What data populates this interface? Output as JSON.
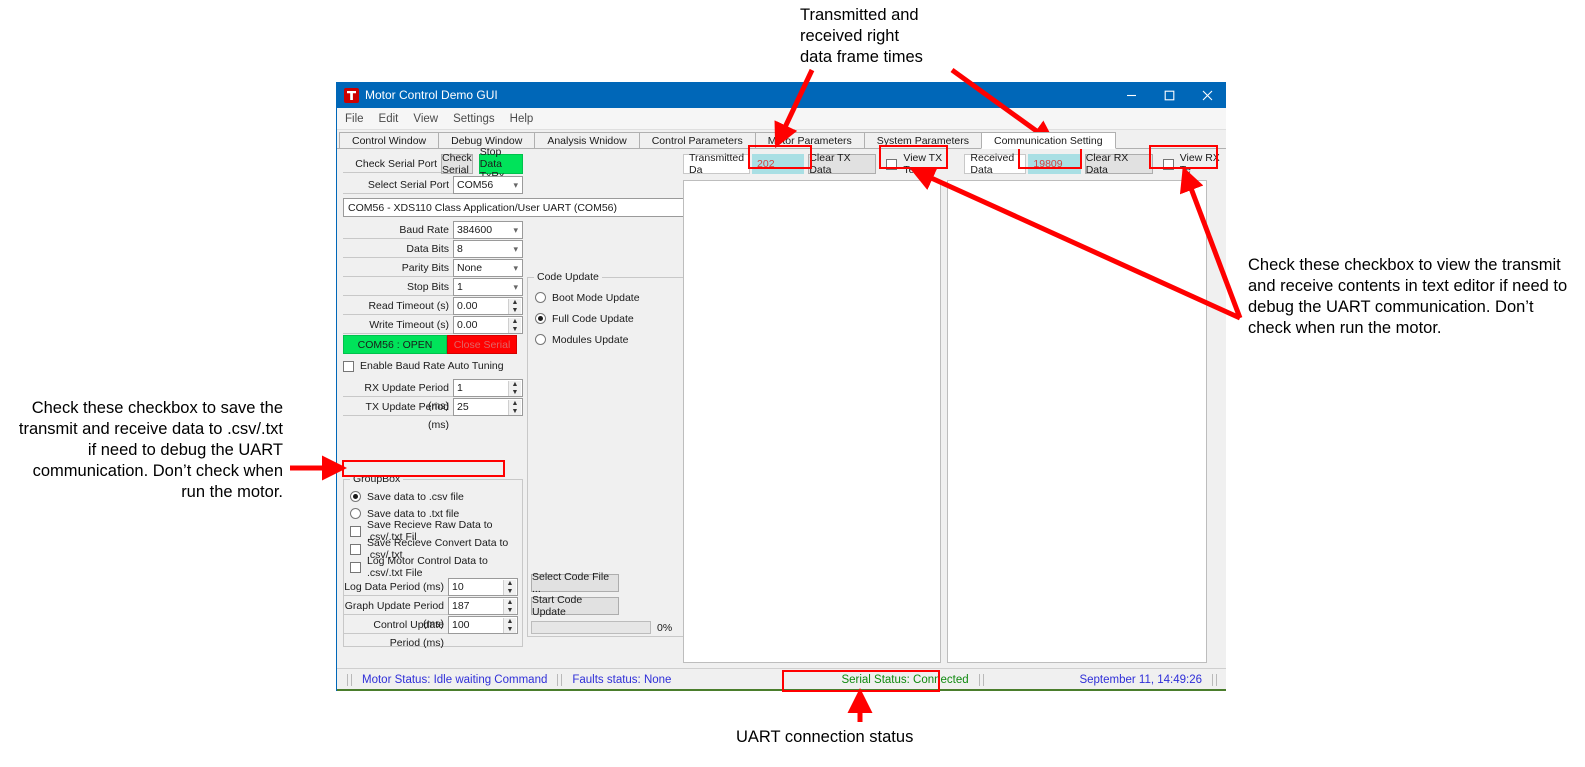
{
  "window": {
    "title": "Motor Control Demo GUI",
    "logo_icon": "ti-logo-icon",
    "minimize_icon": "minimize-icon",
    "maximize_icon": "maximize-icon",
    "close_icon": "close-icon"
  },
  "menubar": {
    "items": [
      "File",
      "Edit",
      "View",
      "Settings",
      "Help"
    ]
  },
  "tabs": [
    {
      "label": "Control Window",
      "active": false
    },
    {
      "label": "Debug Window",
      "active": false
    },
    {
      "label": "Analysis Wnidow",
      "active": false
    },
    {
      "label": "Control Parameters",
      "active": false
    },
    {
      "label": "Motor Parameters",
      "active": false
    },
    {
      "label": "System Parameters",
      "active": false
    },
    {
      "label": "Communication Setting",
      "active": true
    }
  ],
  "serial": {
    "check_label": "Check Serial Port",
    "check_button": "Check Serial",
    "stop_button": "Stop Data TxRx",
    "select_label": "Select Serial Port",
    "select_value": "COM56",
    "port_info": "COM56 - XDS110 Class Application/User UART (COM56)",
    "fields": [
      {
        "label": "Baud Rate",
        "value": "384600",
        "type": "combo"
      },
      {
        "label": "Data Bits",
        "value": "8",
        "type": "combo"
      },
      {
        "label": "Parity Bits",
        "value": "None",
        "type": "combo"
      },
      {
        "label": "Stop Bits",
        "value": "1",
        "type": "combo"
      },
      {
        "label": "Read Timeout (s)",
        "value": "0.00",
        "type": "spin"
      },
      {
        "label": "Write Timeout (s)",
        "value": "0.00",
        "type": "spin"
      }
    ],
    "open_button": "COM56 : OPEN",
    "close_button": "Close Serial",
    "auto_tuning_label": "Enable Baud Rate Auto Tuning",
    "auto_tuning_checked": false,
    "periods": [
      {
        "label": "RX Update Period (ms)",
        "value": "1"
      },
      {
        "label": "TX Update Period (ms)",
        "value": "25"
      }
    ]
  },
  "savegroup": {
    "title": "GroupBox",
    "radios": [
      {
        "label": "Save data to .csv file",
        "checked": true
      },
      {
        "label": "Save data to .txt file",
        "checked": false
      }
    ],
    "checkboxes": [
      {
        "label": "Save Recieve Raw Data to .csv/.txt Fil",
        "checked": false
      },
      {
        "label": "Save Recieve Convert Data to .csv/.txt",
        "checked": false
      },
      {
        "label": "Log Motor Control Data to .csv/.txt File",
        "checked": false
      }
    ],
    "periods": [
      {
        "label": "Log Data Period (ms)",
        "value": "10"
      },
      {
        "label": "Graph Update Period (ms)",
        "value": "187"
      },
      {
        "label": "Control Update Period (ms)",
        "value": "100"
      }
    ]
  },
  "codeupdate": {
    "title": "Code Update",
    "options": [
      {
        "label": "Boot Mode Update",
        "checked": false
      },
      {
        "label": "Full Code Update",
        "checked": true
      },
      {
        "label": "Modules Update",
        "checked": false
      }
    ],
    "select_file_button": "Select Code File ...",
    "start_update_button": "Start Code Update",
    "progress_percent": "0%"
  },
  "datapanels": {
    "tx": {
      "label": "Transmitted Da",
      "value": "202",
      "clear_button": "Clear TX Data",
      "view_label": "View TX Te",
      "view_checked": false
    },
    "rx": {
      "label": "Received Data",
      "value": "19809",
      "clear_button": "Clear RX Data",
      "view_label": "View RX Te",
      "view_checked": false
    }
  },
  "statusbar": {
    "motor_status": "Motor Status: Idle waiting Command",
    "faults_status": "Faults status: None",
    "serial_status": "Serial Status: Connected",
    "timestamp": "September 11, 14:49:26"
  },
  "annotations": {
    "top": "Transmitted and\nreceived right\ndata frame times",
    "right": "Check these checkbox to view the transmit and receive contents in text editor if need to debug the UART communication. Don’t check when run the motor.",
    "left": "Check these checkbox to save the transmit and receive data to .csv/.txt if need to debug the UART communication. Don’t check when run the motor.",
    "bottom": "UART connection status"
  },
  "colors": {
    "accent": "#0067b8",
    "open_green": "#00e35a",
    "close_red": "#ff0000",
    "value_field": "#a9dfe4",
    "value_text": "#d2423f",
    "annotation_red": "#ff0000",
    "status_blue": "#2f2fd8",
    "status_green": "#0f8a0f"
  }
}
